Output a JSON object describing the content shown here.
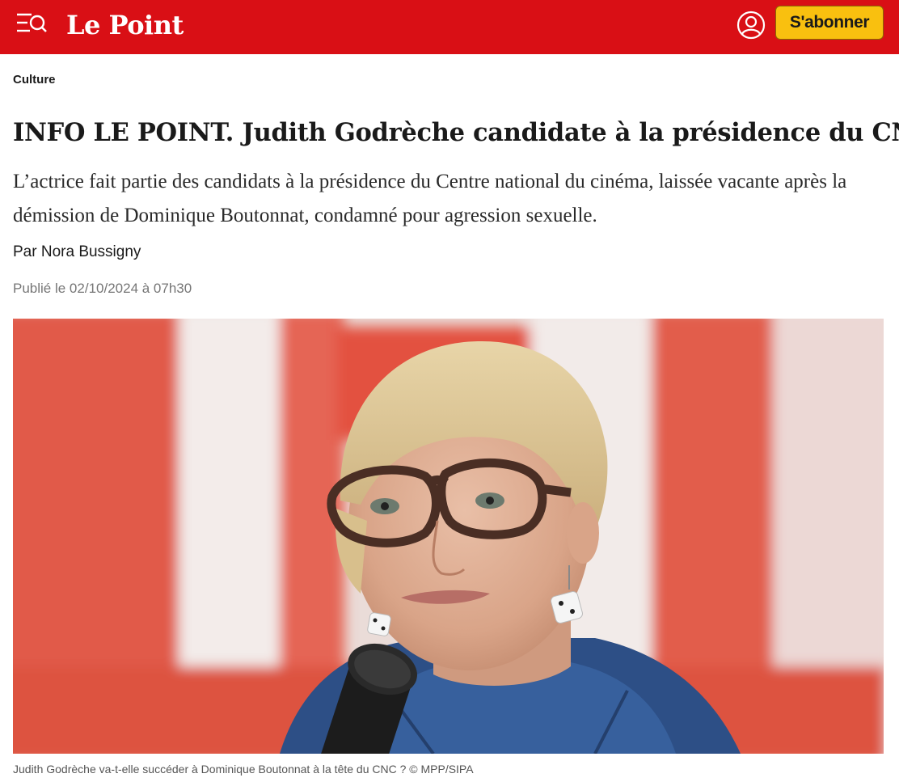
{
  "header": {
    "logo": "Le Point",
    "menu_icon": "menu-search-icon",
    "account_icon": "user-icon",
    "subscribe_label": "S'abonner",
    "brand_color": "#d90f15",
    "subscribe_color": "#f9c00f"
  },
  "article": {
    "rubric": "Culture",
    "title": "INFO LE POINT. Judith Godrèche candidate à la présidence du CNC",
    "lead": "L’actrice fait partie des candidats à la présidence du Centre national du cinéma, laissée vacante après la démission de Dominique Boutonnat, condamné pour agression sexuelle.",
    "byline_prefix": "Par",
    "author": "Nora Bussigny",
    "published": "Publié le 02/10/2024 à 07h30"
  },
  "photo": {
    "caption": "Judith Godrèche va-t-elle succéder à Dominique Boutonnat à la tête du CNC ? © MPP/SIPA"
  }
}
